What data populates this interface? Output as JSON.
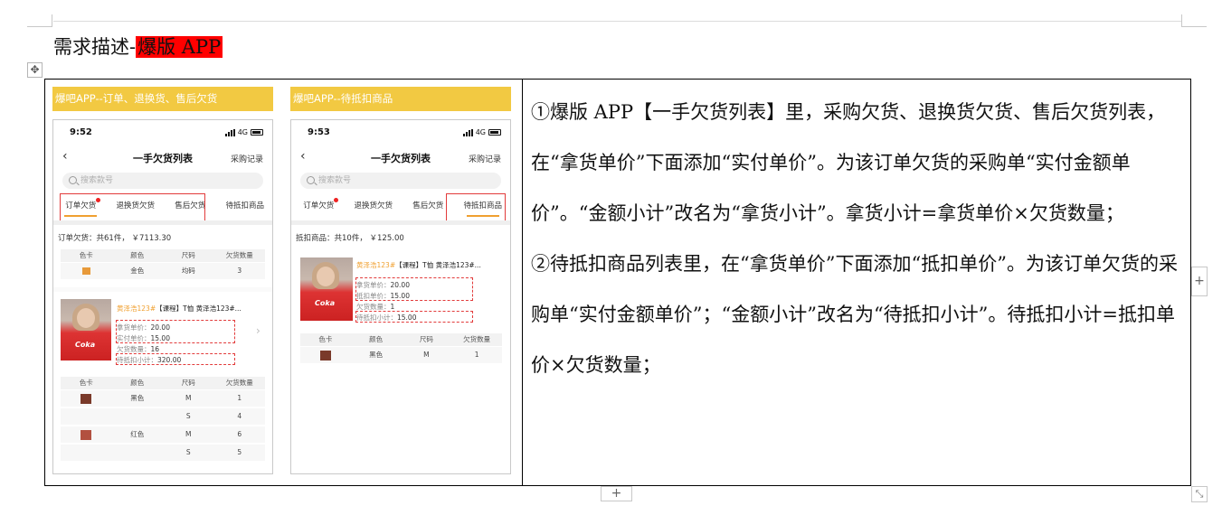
{
  "title": {
    "prefix": "需求描述-",
    "highlight": "爆版 APP"
  },
  "panel_a": {
    "banner": "爆吧APP--订单、退换货、售后欠货",
    "time": "9:52",
    "network": "4G",
    "nav_title": "一手欠货列表",
    "nav_right": "采购记录",
    "search_placeholder": "搜索款号",
    "tabs": [
      "订单欠货",
      "退换货欠货",
      "售后欠货",
      "待抵扣商品"
    ],
    "summary": "订单欠货：共61件， ￥7113.30",
    "grid_headers": [
      "色卡",
      "颜色",
      "尺码",
      "欠货数量"
    ],
    "row1": {
      "color": "金色",
      "size": "均码",
      "qty": "3"
    },
    "product": {
      "code": "黄泽浩123#",
      "name": "【课程】T恤 黄泽浩123#...",
      "price_label": "拿货单价：",
      "price": "20.00",
      "paid_label": "实付单价：",
      "paid": "15.00",
      "qty_label": "欠货数量：",
      "qty": "16",
      "subtotal_label": "待抵扣小计：",
      "subtotal": "320.00",
      "thumb_logo": "Coka"
    },
    "rows2": [
      {
        "color": "黑色",
        "size": "M",
        "qty": "1"
      },
      {
        "color": "",
        "size": "S",
        "qty": "4"
      },
      {
        "color": "红色",
        "size": "M",
        "qty": "6"
      },
      {
        "color": "",
        "size": "S",
        "qty": "5"
      }
    ]
  },
  "panel_b": {
    "banner": "爆吧APP--待抵扣商品",
    "time": "9:53",
    "network": "4G",
    "nav_title": "一手欠货列表",
    "nav_right": "采购记录",
    "search_placeholder": "搜索款号",
    "tabs": [
      "订单欠货",
      "退换货欠货",
      "售后欠货",
      "待抵扣商品"
    ],
    "summary": "抵扣商品：共10件， ￥125.00",
    "grid_headers": [
      "色卡",
      "颜色",
      "尺码",
      "欠货数量"
    ],
    "product": {
      "code": "黄泽浩123#",
      "name": "【课程】T恤 黄泽浩123#...",
      "price_label": "拿货单价：",
      "price": "20.00",
      "deduct_label": "抵扣单价：",
      "deduct": "15.00",
      "qty_label": "欠货数量：",
      "qty": "1",
      "subtotal_label": "待抵扣小计：",
      "subtotal": "15.00",
      "thumb_logo": "Coka"
    },
    "row1": {
      "color": "黑色",
      "size": "M",
      "qty": "1"
    }
  },
  "description": [
    "①爆版 APP【一手欠货列表】里，采购欠货、退换货欠货、售后欠货列表，在“拿货单价”下面添加“实付单价”。为该订单欠货的采购单“实付金额单价”。“金额小计”改名为“拿货小计”。拿货小计=拿货单价×欠货数量；",
    "②待抵扣商品列表里，在“拿货单价”下面添加“抵扣单价”。为该订单欠货的采购单“实付金额单价”；“金额小计”改名为“待抵扣小计”。待抵扣小计=抵扣单价×欠货数量；"
  ],
  "colors": {
    "highlight": "#ff0000",
    "banner": "#f2c942",
    "accent": "#f0a030",
    "annotation": "#e23b3b"
  }
}
